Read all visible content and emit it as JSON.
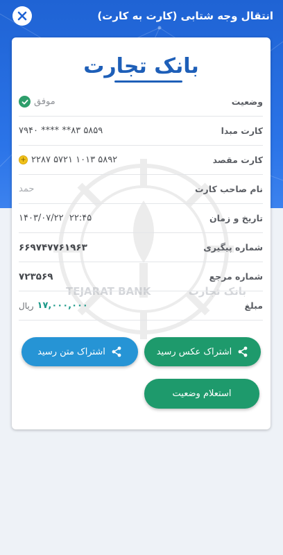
{
  "header": {
    "title": "انتقال وجه شتابی (کارت به کارت)"
  },
  "receipt": {
    "bank_logo": "بانک تجارت",
    "watermark_en": "TEJARAT BANK",
    "watermark_fa": "بانک تجارت",
    "rows": [
      {
        "label": "وضعیت",
        "value": "موفق"
      },
      {
        "label": "کارت مبدا",
        "value": "۵۸۵۹ ۸۳** **** ۷۹۴۰"
      },
      {
        "label": "کارت مقصد",
        "value": "۵۸۹۲ ۱۰۱۳ ۵۷۲۱ ۲۲۸۷"
      },
      {
        "label": "نام صاحب کارت",
        "value": "حمد"
      },
      {
        "label": "تاریخ و زمان",
        "value": "۱۴۰۳/۰۷/۲۲  ۲۲:۴۵"
      },
      {
        "label": "شماره پیگیری",
        "value": "۶۶۹۷۴۷۷۶۱۹۶۳"
      },
      {
        "label": "شماره مرجع",
        "value": "۷۲۳۵۶۹"
      },
      {
        "label": "مبلغ",
        "value": "۱۷,۰۰۰,۰۰۰",
        "unit": "ریال"
      }
    ]
  },
  "buttons": {
    "share_image": "اشتراک عکس رسید",
    "share_text": "اشتراک متن رسید",
    "inquiry": "استعلام وضعیت"
  },
  "colors": {
    "header_blue": "#2b74e8",
    "success_green": "#1e9a6c",
    "share_blue": "#2694d5",
    "amount_teal": "#1d9a8a"
  },
  "icons": [
    "close-icon",
    "check-icon",
    "coin-icon",
    "share-icon"
  ]
}
